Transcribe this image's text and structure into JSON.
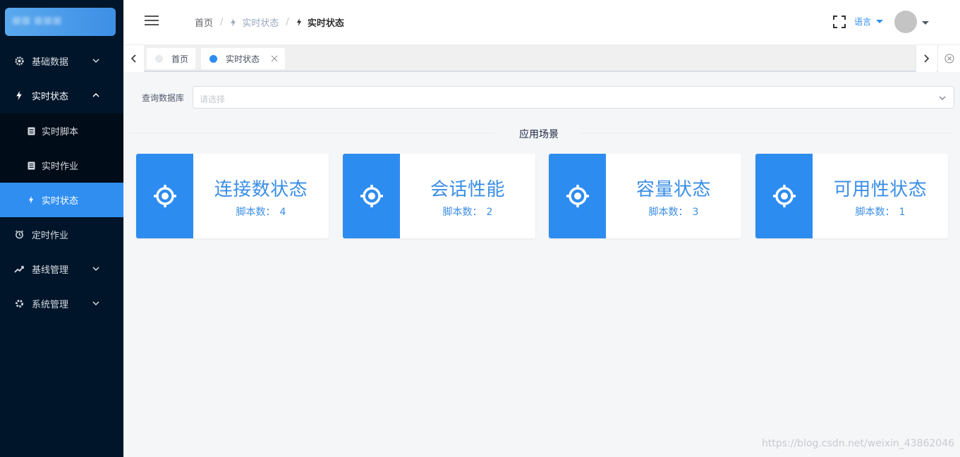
{
  "sidebar": {
    "logo_text": "",
    "items": [
      {
        "label": "基础数据",
        "icon": "settings-icon"
      },
      {
        "label": "实时状态",
        "icon": "flash-icon"
      },
      {
        "label": "定时作业",
        "icon": "alarm-icon"
      },
      {
        "label": "基线管理",
        "icon": "trend-icon"
      },
      {
        "label": "系统管理",
        "icon": "gear-icon"
      }
    ],
    "submenu": [
      {
        "label": "实时脚本",
        "icon": "document-icon"
      },
      {
        "label": "实时作业",
        "icon": "document-icon"
      },
      {
        "label": "实时状态",
        "icon": "flash-icon"
      }
    ]
  },
  "header": {
    "breadcrumb": [
      "首页",
      "实时状态",
      "实时状态"
    ],
    "language_label": "语言"
  },
  "tags": [
    {
      "label": "首页",
      "active": false
    },
    {
      "label": "实时状态",
      "active": true
    }
  ],
  "main": {
    "db_label": "查询数据库",
    "db_placeholder": "请选择",
    "section_title": "应用场景",
    "cards": [
      {
        "title": "连接数状态",
        "count_label": "脚本数：",
        "count": "4"
      },
      {
        "title": "会话性能",
        "count_label": "脚本数：",
        "count": "2"
      },
      {
        "title": "容量状态",
        "count_label": "脚本数：",
        "count": "3"
      },
      {
        "title": "可用性状态",
        "count_label": "脚本数：",
        "count": "1"
      }
    ]
  },
  "watermark": "https://blog.csdn.net/weixin_43862046",
  "colors": {
    "sidebar_bg": "#001529",
    "accent": "#2d8cf0",
    "card_text": "#3b8ee6"
  }
}
